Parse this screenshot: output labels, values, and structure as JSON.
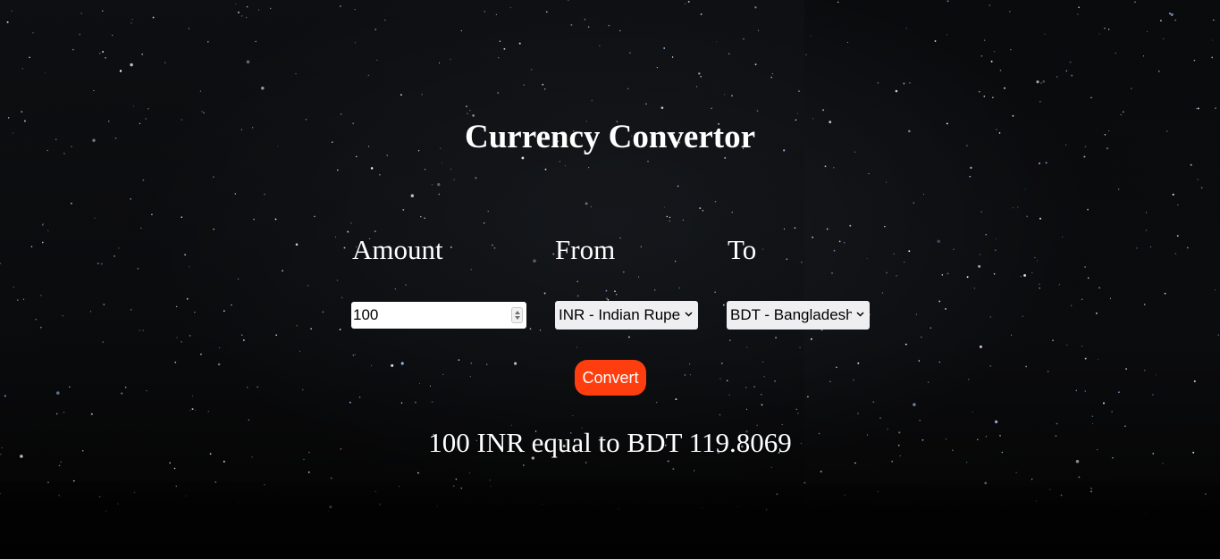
{
  "page": {
    "title": "Currency Convertor"
  },
  "form": {
    "amount_label": "Amount",
    "from_label": "From",
    "to_label": "To",
    "amount_value": "100",
    "from_selected": "INR - Indian Rupee",
    "to_selected": "BDT - Bangladeshi Taka",
    "convert_label": "Convert"
  },
  "result": {
    "text": "100 INR equal to BDT 119.8069"
  },
  "colors": {
    "background": "#050505",
    "text": "#ffffff",
    "button": "#ff3e0f"
  }
}
